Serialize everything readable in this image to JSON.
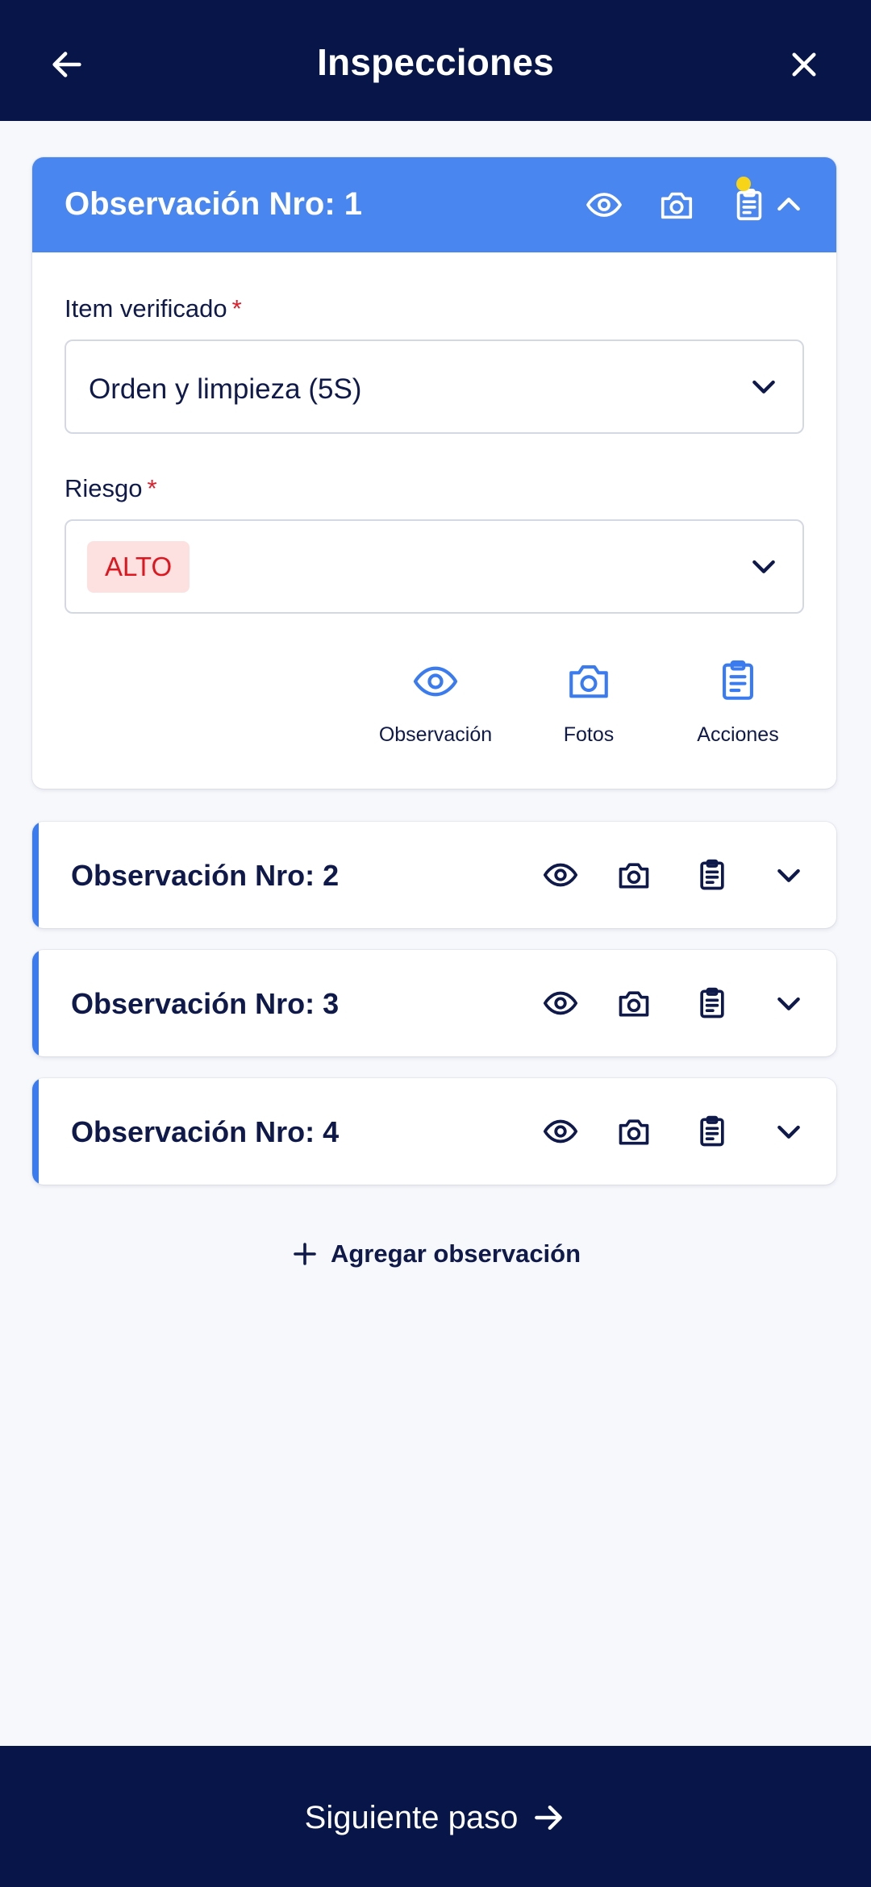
{
  "header": {
    "title": "Inspecciones",
    "back_icon": "arrow-left-icon",
    "close_icon": "close-icon"
  },
  "colors": {
    "nav_bg": "#071548",
    "card_header": "#4a86ef",
    "accent": "#3a7bef",
    "risk_text": "#e0161f",
    "risk_bg": "#fde1e1",
    "notification_dot": "#f7d417"
  },
  "observations": [
    {
      "title": "Observación Nro: 1",
      "expanded": true,
      "has_notification": true,
      "fields": {
        "item_label": "Item verificado",
        "item_value": "Orden y limpieza (5S)",
        "risk_label": "Riesgo",
        "risk_value": "ALTO",
        "required_mark": "*"
      },
      "actions": [
        {
          "label": "Observación",
          "icon": "eye-icon"
        },
        {
          "label": "Fotos",
          "icon": "camera-icon"
        },
        {
          "label": "Acciones",
          "icon": "clipboard-icon"
        }
      ]
    },
    {
      "title": "Observación Nro: 2",
      "expanded": false
    },
    {
      "title": "Observación Nro: 3",
      "expanded": false
    },
    {
      "title": "Observación Nro: 4",
      "expanded": false
    }
  ],
  "add_observation_label": "Agregar observación",
  "footer": {
    "next_label": "Siguiente paso",
    "next_icon": "arrow-right-icon"
  }
}
